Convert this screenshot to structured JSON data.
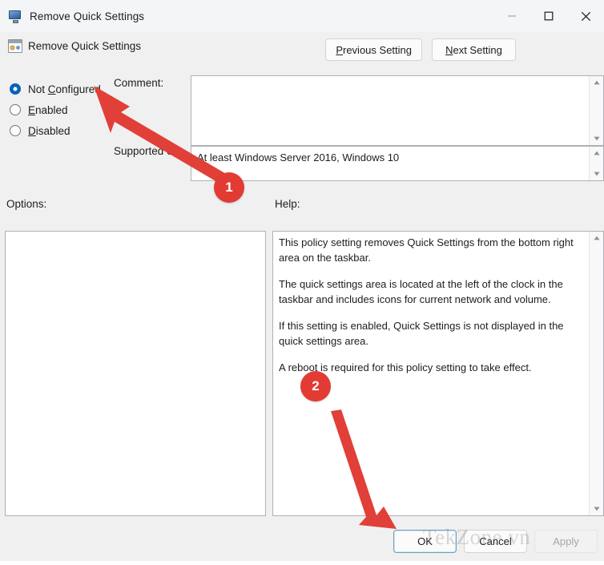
{
  "window": {
    "title": "Remove Quick Settings",
    "icon": "monitor-icon",
    "controls": {
      "minimize": "minimize-icon",
      "maximize": "maximize-icon",
      "close": "close-icon"
    }
  },
  "header": {
    "policy_icon": "policy-setting-icon",
    "policy_title": "Remove Quick Settings",
    "previous_button": "Previous Setting",
    "previous_accel": "P",
    "next_button": "Next Setting",
    "next_accel": "N"
  },
  "state": {
    "options": [
      {
        "label": "Not Configured",
        "accel": "C",
        "pre": "Not ",
        "post": "onfigured",
        "selected": true
      },
      {
        "label": "Enabled",
        "accel": "E",
        "pre": "",
        "post": "nabled",
        "selected": false
      },
      {
        "label": "Disabled",
        "accel": "D",
        "pre": "",
        "post": "isabled",
        "selected": false
      }
    ]
  },
  "labels": {
    "comment": "Comment:",
    "supported_on": "Supported on:",
    "options": "Options:",
    "help": "Help:"
  },
  "comment": {
    "value": ""
  },
  "supported_on": {
    "value": "At least Windows Server 2016, Windows 10"
  },
  "options_panel": {
    "value": ""
  },
  "help_panel": {
    "paragraphs": [
      "This policy setting removes Quick Settings from the bottom right area on the taskbar.",
      "The quick settings area is located at the left of the clock in the taskbar and includes icons for current network and volume.",
      "If this setting is enabled, Quick Settings is not displayed in the quick settings area.",
      "A reboot is required for this policy setting to take effect."
    ]
  },
  "footer": {
    "ok": "OK",
    "cancel": "Cancel",
    "apply": "Apply",
    "apply_disabled": true
  },
  "watermark": {
    "text": "TekZone.vn"
  },
  "annotations": {
    "badges": [
      {
        "number": "1",
        "target": "not-configured-radio"
      },
      {
        "number": "2",
        "target": "ok-button"
      }
    ],
    "arrow_color": "#e04038"
  }
}
